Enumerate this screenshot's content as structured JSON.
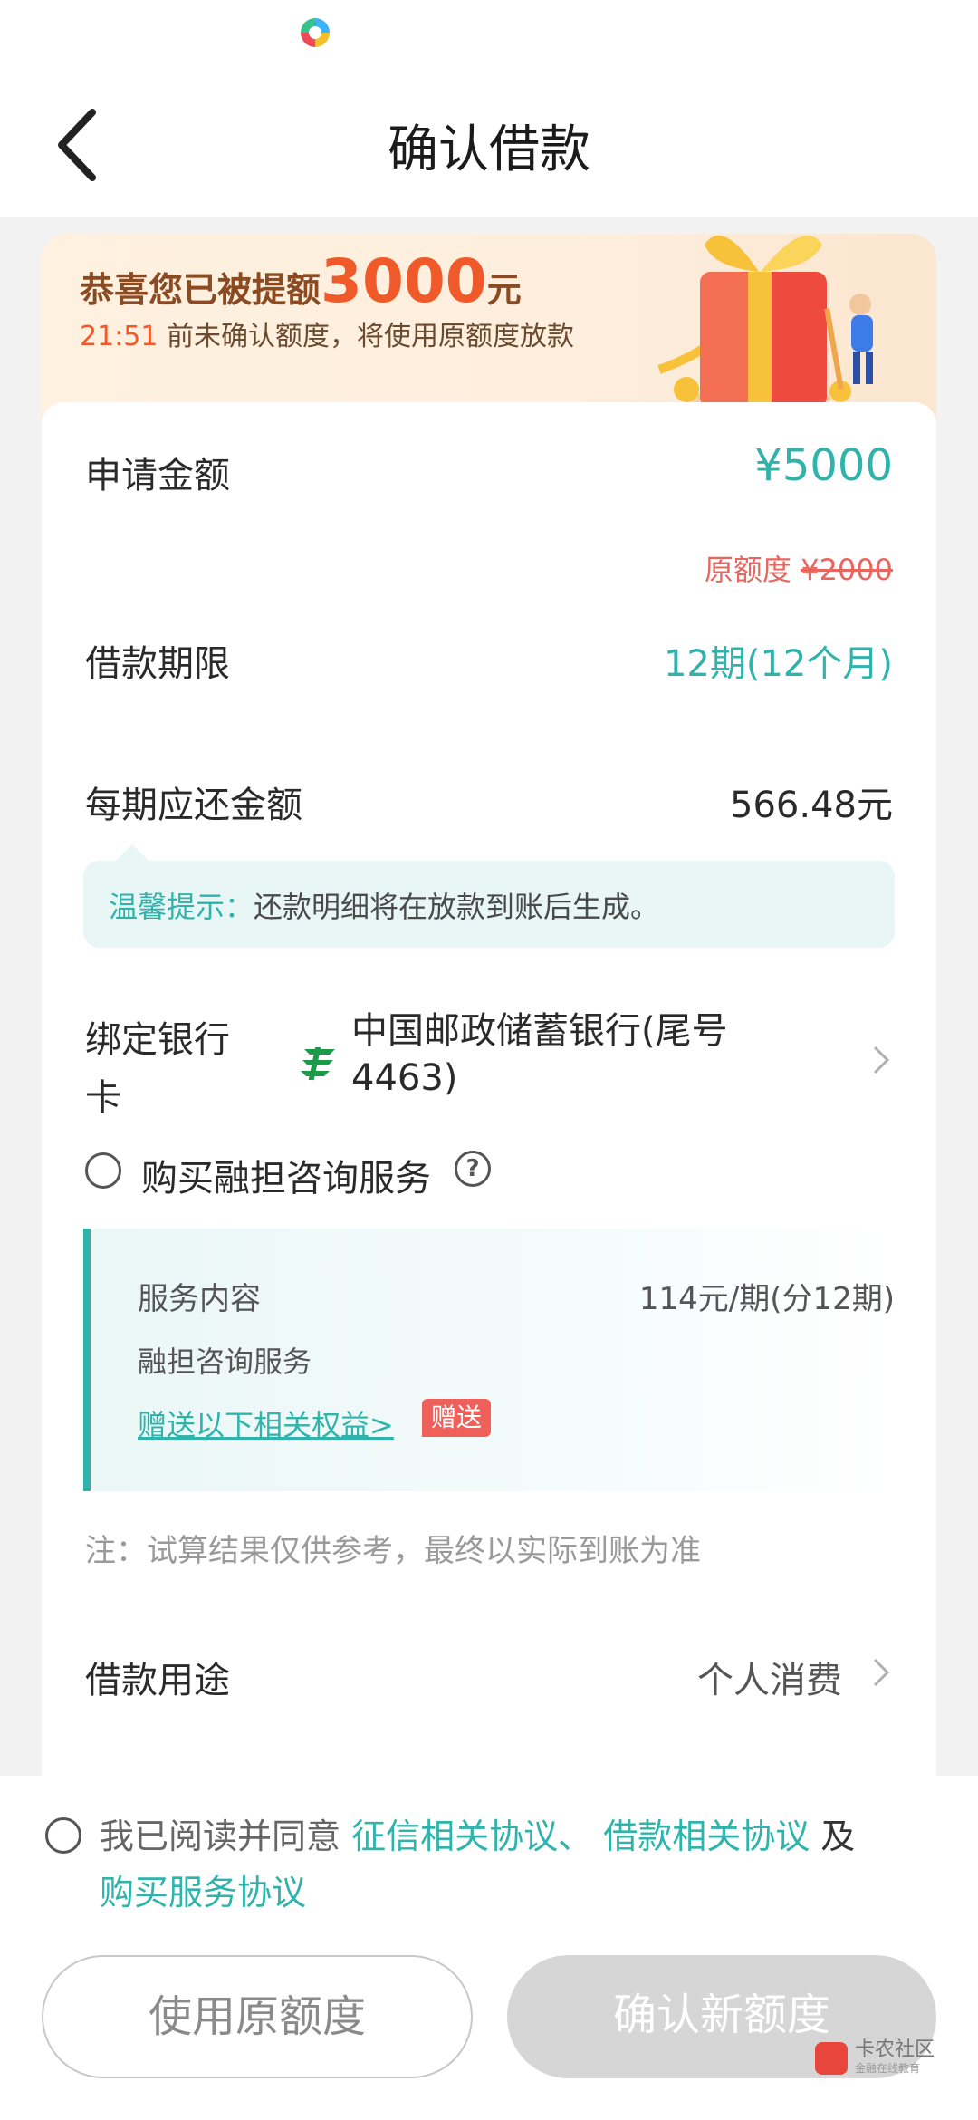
{
  "nav": {
    "title": "确认借款"
  },
  "banner": {
    "prefix": "恭喜您已被提额",
    "amount": "3000",
    "suffix": "元",
    "time": "21:51",
    "message": " 前未确认额度，将使用原额度放款"
  },
  "loan": {
    "amount_label": "申请金额",
    "amount_value": "¥5000",
    "old_limit_label": "原额度 ",
    "old_limit_value": "¥2000",
    "term_label": "借款期限",
    "term_value": "12期(12个月)",
    "installment_label": "每期应还金额",
    "installment_value": "566.48元"
  },
  "tip": {
    "label": "温馨提示：",
    "text": "还款明细将在放款到账后生成。"
  },
  "bank": {
    "label": "绑定银行卡",
    "name": "中国邮政储蓄银行(尾号4463)"
  },
  "service": {
    "checkbox_label": "购买融担咨询服务",
    "help": "?",
    "content_title": "服务内容",
    "price": "114元/期(分12期)",
    "name": "融担咨询服务",
    "benefit_link": "赠送以下相关权益>",
    "badge": "赠送"
  },
  "note": "注：试算结果仅供参考，最终以实际到账为准",
  "purpose": {
    "label": "借款用途",
    "value": "个人消费"
  },
  "agreement": {
    "prefix": "我已阅读并同意 ",
    "link1": "征信相关协议、",
    "link2": " 借款相关协议",
    "mid": " 及",
    "link3": "购买服务协议"
  },
  "buttons": {
    "original": "使用原额度",
    "confirm": "确认新额度"
  },
  "watermark": {
    "title": "卡农社区",
    "subtitle": "金融在线教育"
  },
  "colors": {
    "accent": "#2fb3aa",
    "warning": "#f05a2a",
    "badge": "#f0605a"
  }
}
